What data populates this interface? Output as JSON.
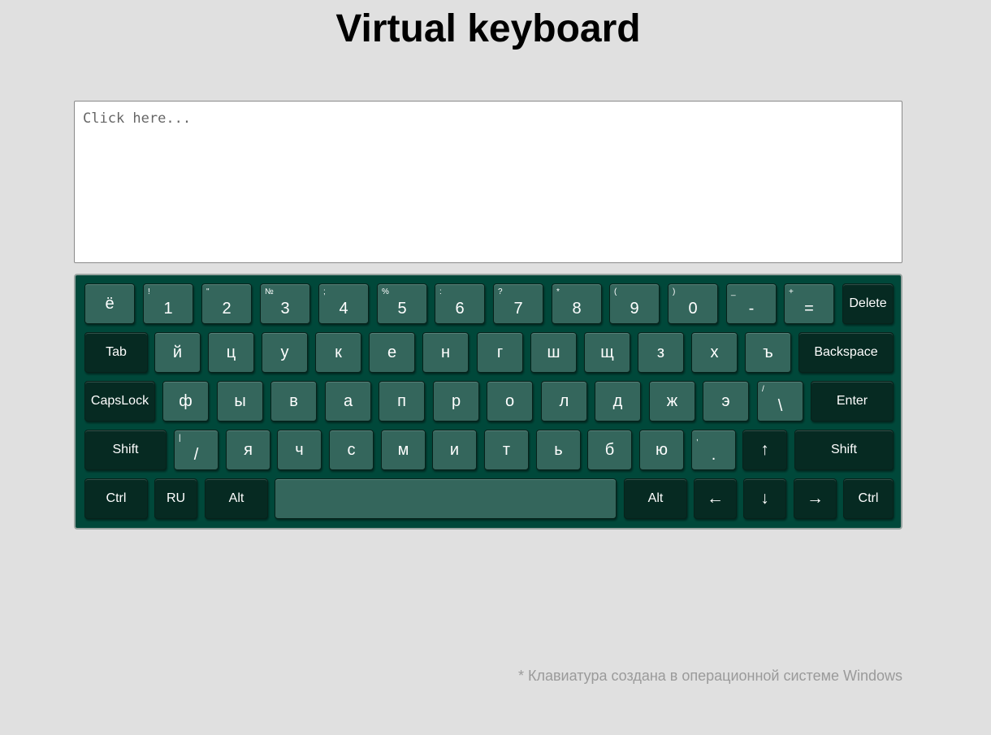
{
  "title": "Virtual keyboard",
  "input": {
    "placeholder": "Click here...",
    "value": ""
  },
  "keyboard": {
    "colors": {
      "base": "#00483a",
      "key_light": "#34665c",
      "key_dark": "#062a22"
    },
    "row1": [
      {
        "main": "ё",
        "sup": "",
        "style": "light"
      },
      {
        "main": "1",
        "sup": "!",
        "style": "light"
      },
      {
        "main": "2",
        "sup": "\"",
        "style": "light"
      },
      {
        "main": "3",
        "sup": "№",
        "style": "light"
      },
      {
        "main": "4",
        "sup": ";",
        "style": "light"
      },
      {
        "main": "5",
        "sup": "%",
        "style": "light"
      },
      {
        "main": "6",
        "sup": ":",
        "style": "light"
      },
      {
        "main": "7",
        "sup": "?",
        "style": "light"
      },
      {
        "main": "8",
        "sup": "*",
        "style": "light"
      },
      {
        "main": "9",
        "sup": "(",
        "style": "light"
      },
      {
        "main": "0",
        "sup": ")",
        "style": "light"
      },
      {
        "main": "-",
        "sup": "_",
        "style": "light"
      },
      {
        "main": "=",
        "sup": "+",
        "style": "light"
      },
      {
        "main": "Delete",
        "sup": "",
        "style": "dark"
      }
    ],
    "row2": [
      {
        "main": "Tab",
        "sup": "",
        "style": "dark"
      },
      {
        "main": "й",
        "sup": "",
        "style": "light"
      },
      {
        "main": "ц",
        "sup": "",
        "style": "light"
      },
      {
        "main": "у",
        "sup": "",
        "style": "light"
      },
      {
        "main": "к",
        "sup": "",
        "style": "light"
      },
      {
        "main": "е",
        "sup": "",
        "style": "light"
      },
      {
        "main": "н",
        "sup": "",
        "style": "light"
      },
      {
        "main": "г",
        "sup": "",
        "style": "light"
      },
      {
        "main": "ш",
        "sup": "",
        "style": "light"
      },
      {
        "main": "щ",
        "sup": "",
        "style": "light"
      },
      {
        "main": "з",
        "sup": "",
        "style": "light"
      },
      {
        "main": "х",
        "sup": "",
        "style": "light"
      },
      {
        "main": "ъ",
        "sup": "",
        "style": "light"
      },
      {
        "main": "Backspace",
        "sup": "",
        "style": "dark"
      }
    ],
    "row3": [
      {
        "main": "CapsLock",
        "sup": "",
        "style": "dark"
      },
      {
        "main": "ф",
        "sup": "",
        "style": "light"
      },
      {
        "main": "ы",
        "sup": "",
        "style": "light"
      },
      {
        "main": "в",
        "sup": "",
        "style": "light"
      },
      {
        "main": "а",
        "sup": "",
        "style": "light"
      },
      {
        "main": "п",
        "sup": "",
        "style": "light"
      },
      {
        "main": "р",
        "sup": "",
        "style": "light"
      },
      {
        "main": "о",
        "sup": "",
        "style": "light"
      },
      {
        "main": "л",
        "sup": "",
        "style": "light"
      },
      {
        "main": "д",
        "sup": "",
        "style": "light"
      },
      {
        "main": "ж",
        "sup": "",
        "style": "light"
      },
      {
        "main": "э",
        "sup": "",
        "style": "light"
      },
      {
        "main": "\\",
        "sup": "/",
        "style": "light"
      },
      {
        "main": "Enter",
        "sup": "",
        "style": "dark"
      }
    ],
    "row4": [
      {
        "main": "Shift",
        "sup": "",
        "style": "dark"
      },
      {
        "main": "/",
        "sup": "|",
        "style": "light"
      },
      {
        "main": "я",
        "sup": "",
        "style": "light"
      },
      {
        "main": "ч",
        "sup": "",
        "style": "light"
      },
      {
        "main": "с",
        "sup": "",
        "style": "light"
      },
      {
        "main": "м",
        "sup": "",
        "style": "light"
      },
      {
        "main": "и",
        "sup": "",
        "style": "light"
      },
      {
        "main": "т",
        "sup": "",
        "style": "light"
      },
      {
        "main": "ь",
        "sup": "",
        "style": "light"
      },
      {
        "main": "б",
        "sup": "",
        "style": "light"
      },
      {
        "main": "ю",
        "sup": "",
        "style": "light"
      },
      {
        "main": ".",
        "sup": ",",
        "style": "light"
      },
      {
        "main": "↑",
        "sup": "",
        "style": "dark"
      },
      {
        "main": "Shift",
        "sup": "",
        "style": "dark"
      }
    ],
    "row5": [
      {
        "main": "Ctrl",
        "sup": "",
        "style": "dark"
      },
      {
        "main": "RU",
        "sup": "",
        "style": "dark"
      },
      {
        "main": "Alt",
        "sup": "",
        "style": "dark"
      },
      {
        "main": "",
        "sup": "",
        "style": "light"
      },
      {
        "main": "Alt",
        "sup": "",
        "style": "dark"
      },
      {
        "main": "←",
        "sup": "",
        "style": "dark"
      },
      {
        "main": "↓",
        "sup": "",
        "style": "dark"
      },
      {
        "main": "→",
        "sup": "",
        "style": "dark"
      },
      {
        "main": "Ctrl",
        "sup": "",
        "style": "dark"
      }
    ]
  },
  "footnote": "* Клавиатура создана в операционной системе Windows"
}
